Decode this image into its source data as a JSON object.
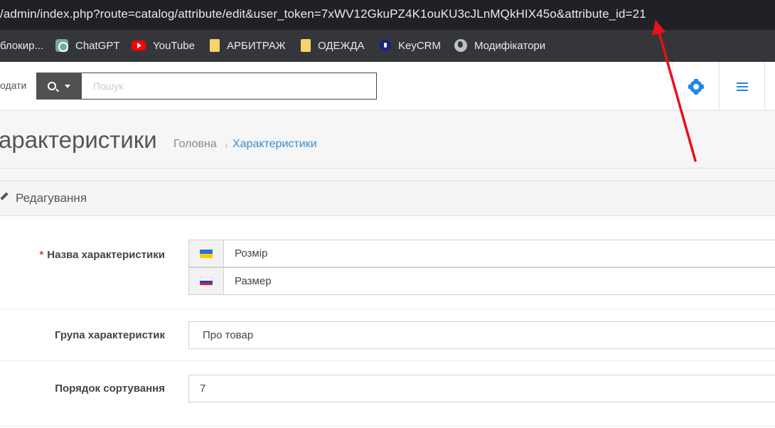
{
  "browser": {
    "url_prefix": "/admin/index.php?route=catalog/attribute/edit&user_token=7xWV12GkuPZ4K1ouKU3cJLnMQkHIX45o&attribute_id=21",
    "bookmarks": [
      {
        "label": "блокир...",
        "icon": "none"
      },
      {
        "label": "ChatGPT",
        "icon": "chatgpt-icon"
      },
      {
        "label": "YouTube",
        "icon": "youtube-icon"
      },
      {
        "label": "АРБИТРАЖ",
        "icon": "folder-icon"
      },
      {
        "label": "ОДЕЖДА",
        "icon": "folder-icon"
      },
      {
        "label": "KeyCRM",
        "icon": "keycrm-icon"
      },
      {
        "label": "Модифікатори",
        "icon": "globe-icon"
      }
    ]
  },
  "header": {
    "left_label": "одати",
    "search_placeholder": "Пошук",
    "icons": [
      "search-icon",
      "caret-down-icon",
      "gear-icon",
      "menu-icon"
    ]
  },
  "page": {
    "title": "арактеристики",
    "breadcrumb_home": "Головна",
    "breadcrumb_sep": "›",
    "breadcrumb_current": "Характеристики"
  },
  "panel": {
    "title": "Редагування",
    "required_mark": "*",
    "name_label": "Назва характеристики",
    "name_uk": "Розмір",
    "name_ru": "Размер",
    "group_label": "Група характеристик",
    "group_value": "Про товар",
    "sort_label": "Порядок сортування",
    "sort_value": "7"
  },
  "colors": {
    "annotation_arrow": "#e8101a",
    "accent": "#1e88e5",
    "link": "#3a8ccf"
  }
}
